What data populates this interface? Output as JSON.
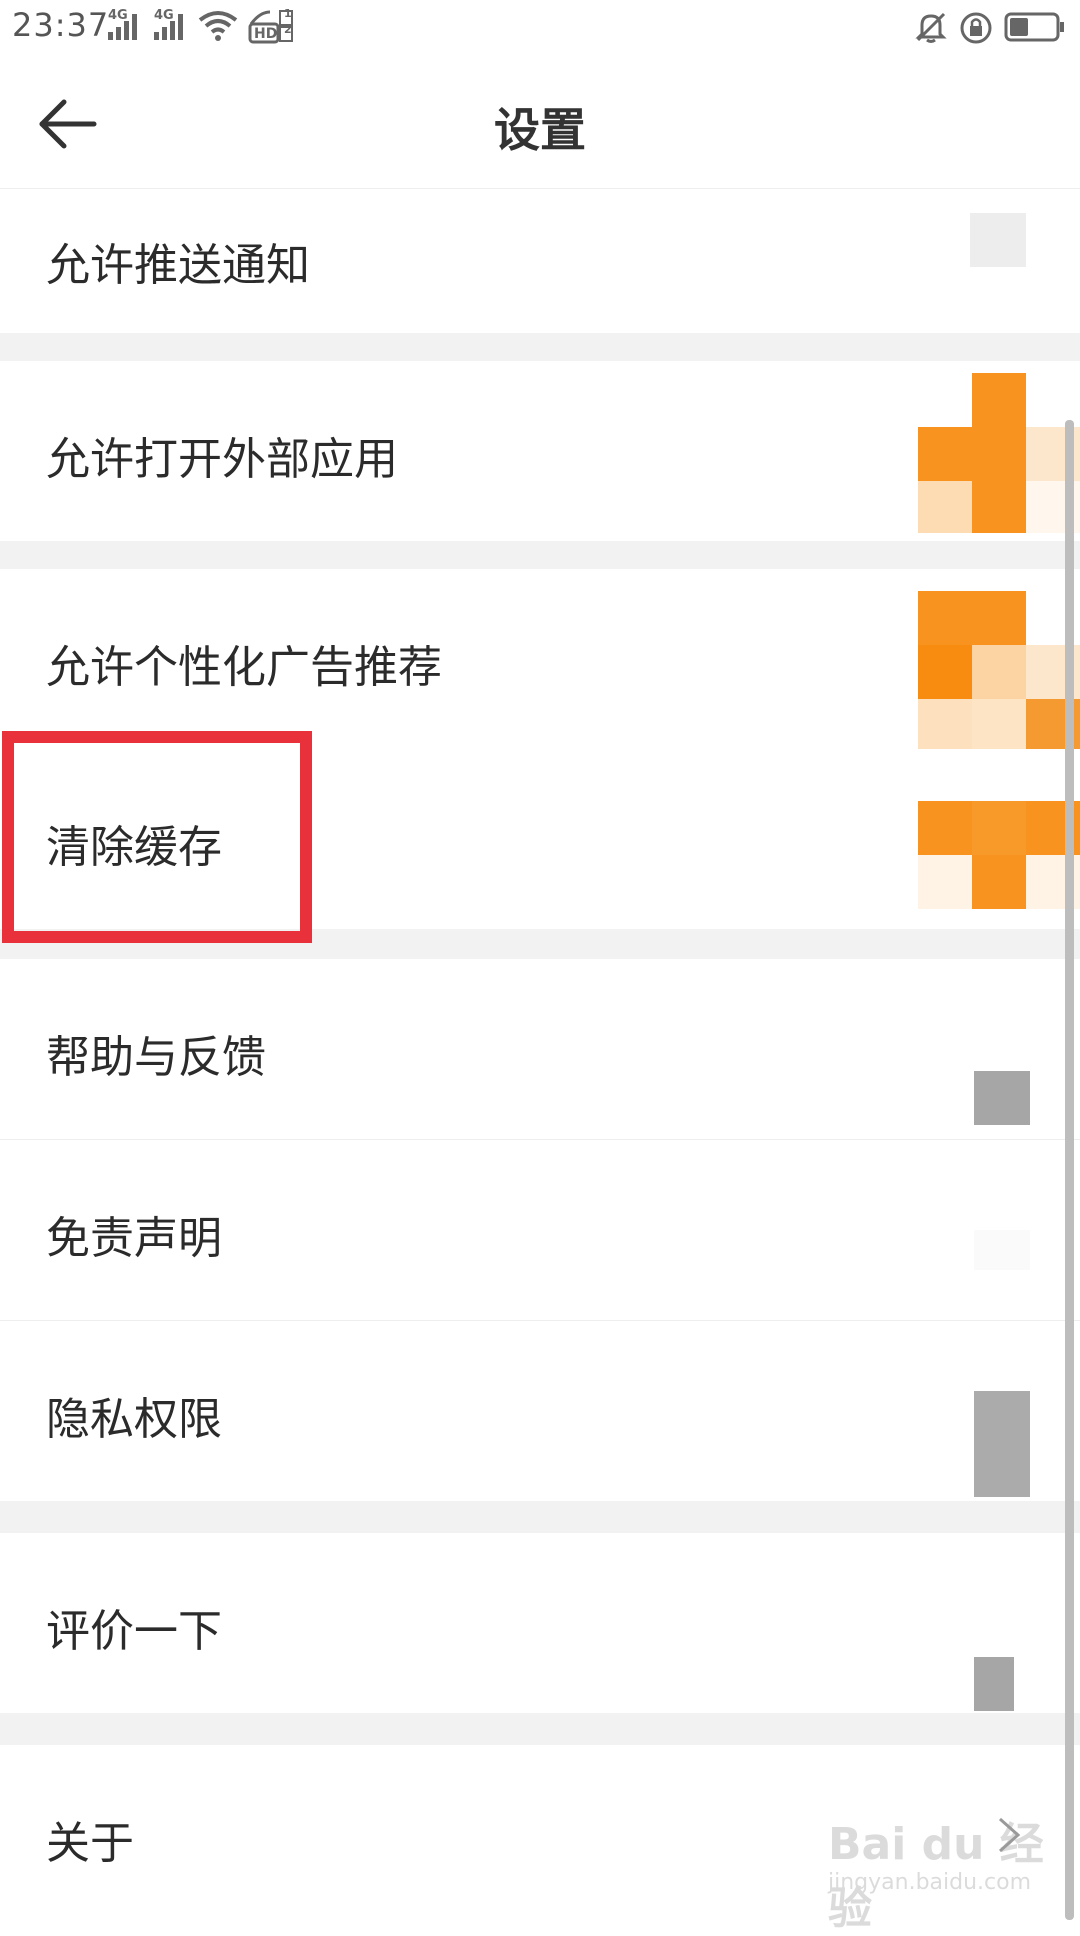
{
  "status": {
    "time": "23:37",
    "sim1_net": "4G",
    "sim2_net": "4G",
    "hd_label": "HD",
    "hd_sub1": "1",
    "hd_sub2": "2",
    "icons": [
      "signal-icon",
      "wifi-icon",
      "hd-icon",
      "mute-icon",
      "rotation-lock-icon",
      "battery-icon"
    ],
    "battery_level": 0.4
  },
  "header": {
    "title": "设置",
    "back_icon": "arrow-left-icon"
  },
  "settings": {
    "items": [
      {
        "label": "允许推送通知"
      },
      {
        "label": "允许打开外部应用"
      },
      {
        "label": "允许个性化广告推荐"
      },
      {
        "label": "清除缓存"
      },
      {
        "label": "帮助与反馈"
      },
      {
        "label": "免责声明"
      },
      {
        "label": "隐私权限"
      },
      {
        "label": "评价一下"
      },
      {
        "label": "关于"
      }
    ]
  },
  "watermark": {
    "main": "Bai du 经验",
    "sub": "jingyan.baidu.com"
  },
  "colors": {
    "accent": "#f7931e",
    "highlight": "#e8313b",
    "divider": "#eeeeee",
    "gap": "#f2f2f2",
    "text": "#2b2b2b"
  }
}
